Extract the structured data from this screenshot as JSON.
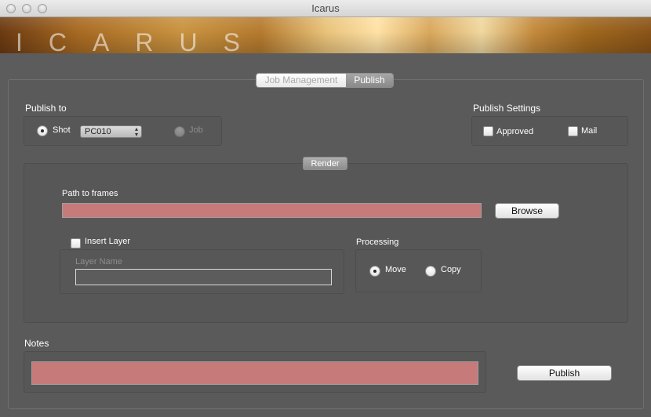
{
  "window": {
    "title": "Icarus"
  },
  "banner": {
    "logo_text": "ICARUS"
  },
  "tabs": [
    {
      "label": "Job Management",
      "active": false
    },
    {
      "label": "Publish",
      "active": true
    }
  ],
  "publish_to": {
    "label": "Publish to",
    "shot_label": "Shot",
    "shot_selected": true,
    "shot_value": "PC010",
    "job_label": "Job",
    "job_enabled": false
  },
  "publish_settings": {
    "label": "Publish Settings",
    "approved_label": "Approved",
    "approved_checked": false,
    "mail_label": "Mail",
    "mail_checked": false
  },
  "render": {
    "label": "Render",
    "path_label": "Path to frames",
    "path_value": "",
    "browse_label": "Browse",
    "insert_layer_label": "Insert Layer",
    "insert_layer_checked": false,
    "layer_name_label": "Layer Name",
    "layer_name_value": "",
    "processing_label": "Processing",
    "move_label": "Move",
    "copy_label": "Copy",
    "selected_processing": "Move"
  },
  "notes": {
    "label": "Notes",
    "value": ""
  },
  "publish_button": {
    "label": "Publish"
  },
  "colors": {
    "error_field": "#c77a7a",
    "background": "#5c5c5c"
  }
}
